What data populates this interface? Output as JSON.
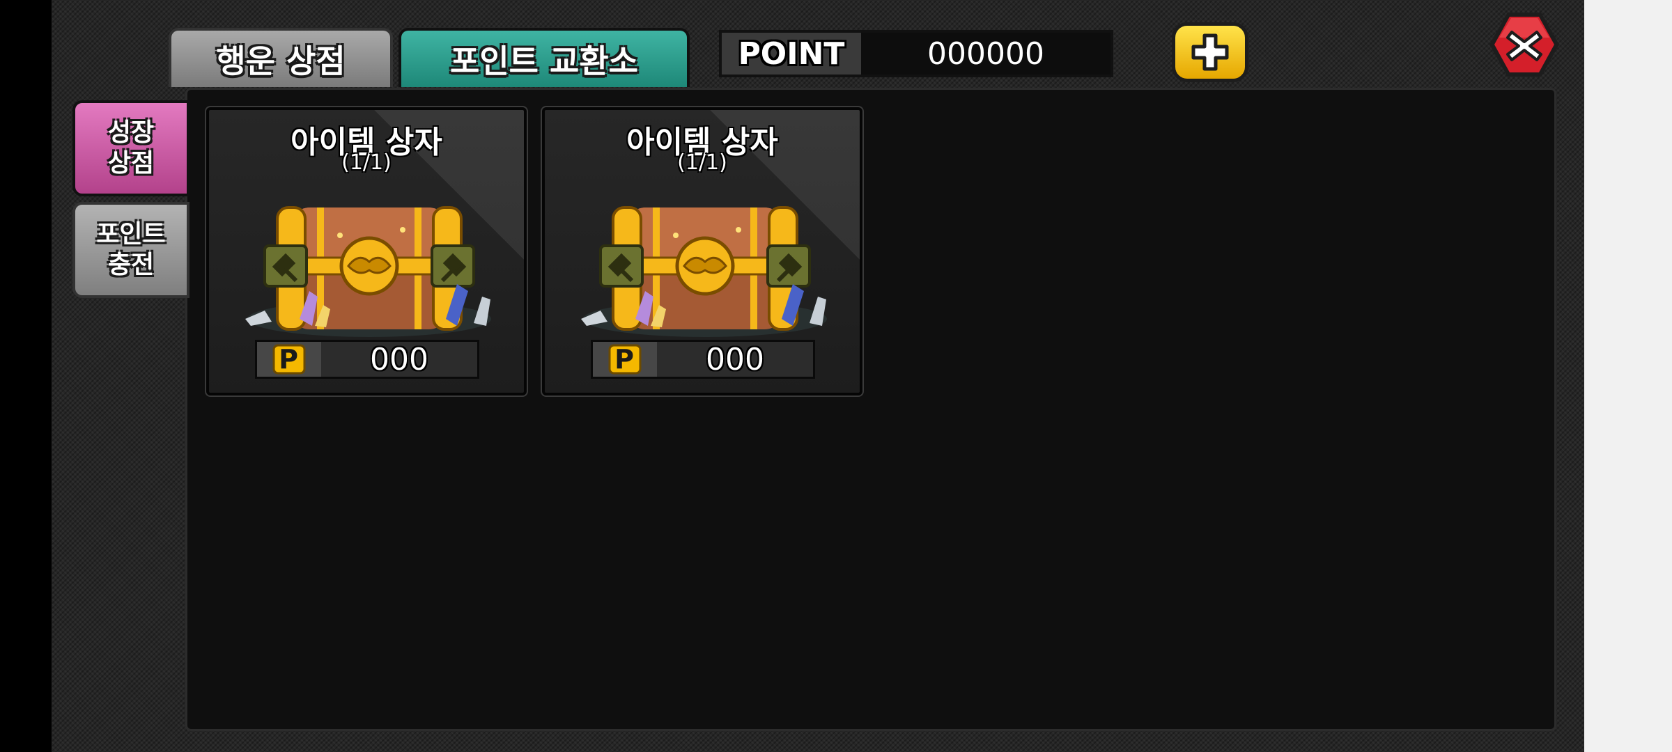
{
  "colors": {
    "accent_teal": "#2aa291",
    "accent_pink": "#cc5aa3",
    "gold": "#f5b800",
    "close_red": "#d41f2a"
  },
  "top_tabs": [
    {
      "label": "행운 상점",
      "active": false
    },
    {
      "label": "포인트 교환소",
      "active": true
    }
  ],
  "point": {
    "label": "POINT",
    "value": "000000"
  },
  "icons": {
    "plus": "plus-icon",
    "close": "close-icon",
    "item": "treasure-chest-icon",
    "currency": "point-coin-icon"
  },
  "side_tabs": [
    {
      "label": "성장\n상점",
      "active": true
    },
    {
      "label": "포인트\n충전",
      "active": false
    }
  ],
  "items": [
    {
      "title": "아이템 상자",
      "stock": "(1/1)",
      "currency": "P",
      "price": "000"
    },
    {
      "title": "아이템 상자",
      "stock": "(1/1)",
      "currency": "P",
      "price": "000"
    }
  ]
}
